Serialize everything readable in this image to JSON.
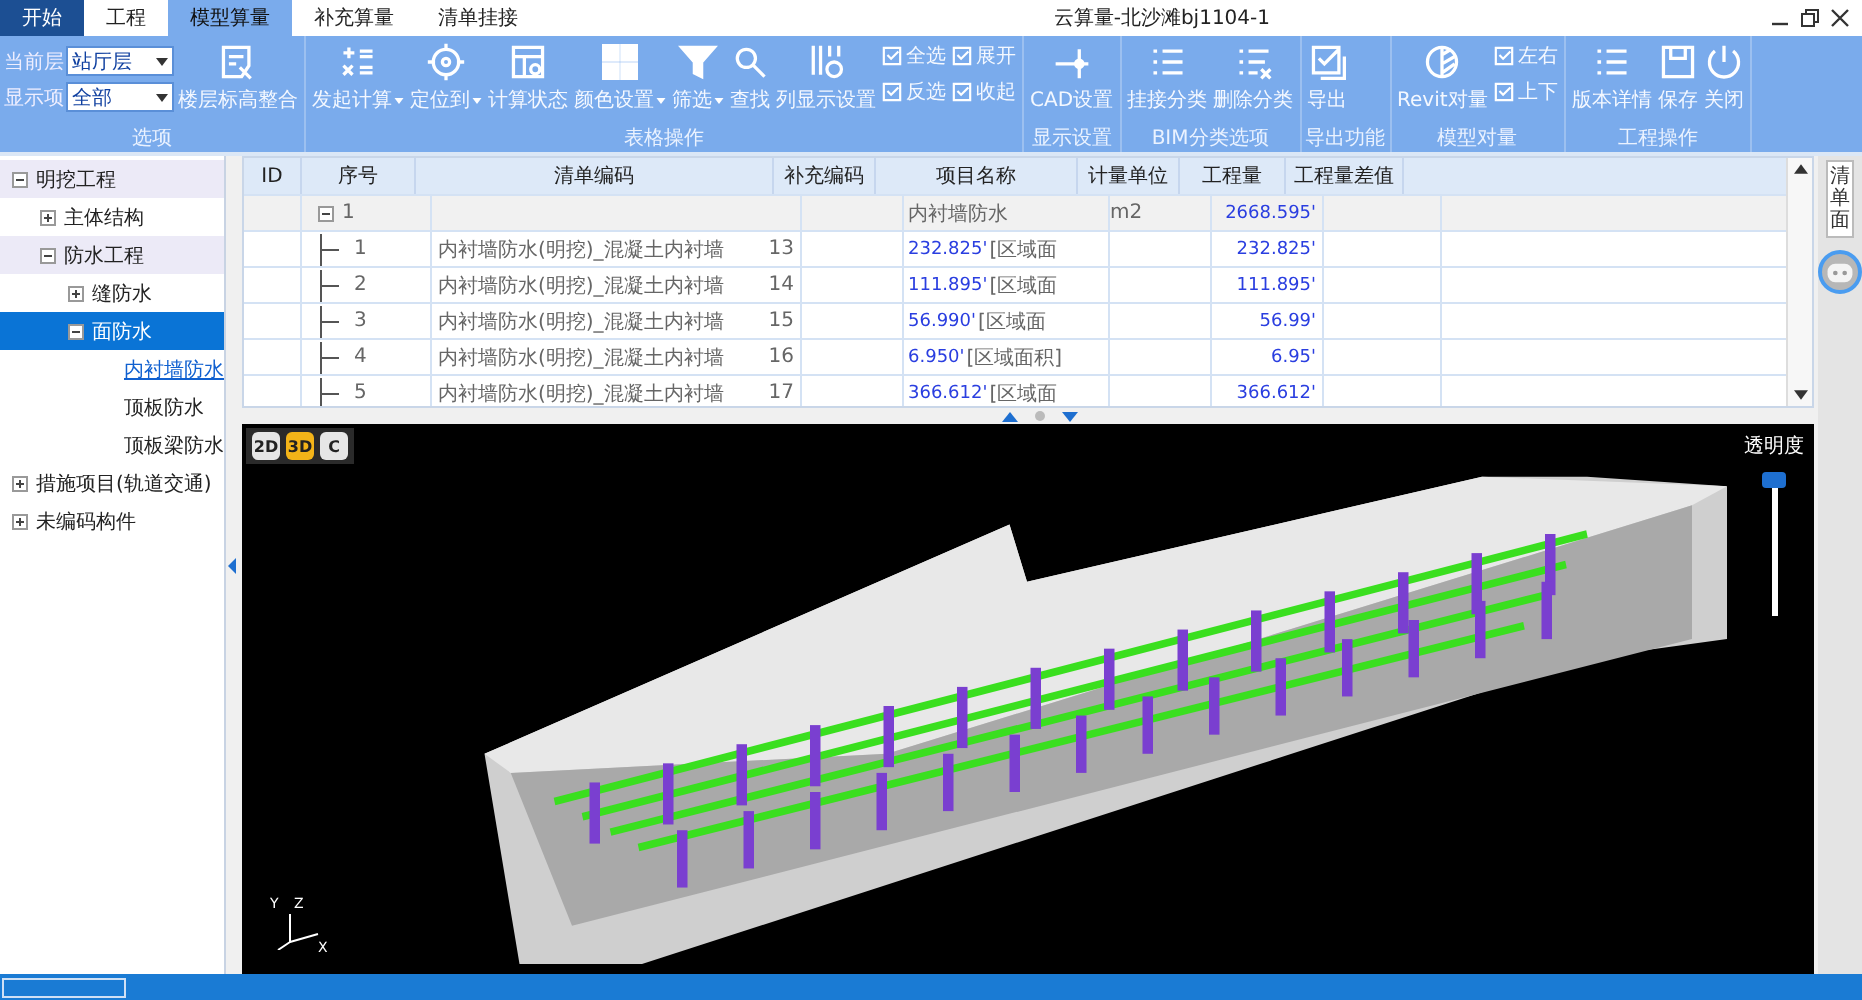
{
  "window": {
    "title": "云算量-北沙滩bj1104-1"
  },
  "tabs": [
    {
      "label": "开始",
      "kind": "start",
      "selected": false
    },
    {
      "label": "工程",
      "kind": "tab",
      "selected": false
    },
    {
      "label": "模型算量",
      "kind": "tab",
      "selected": true
    },
    {
      "label": "补充算量",
      "kind": "tab",
      "selected": false
    },
    {
      "label": "清单挂接",
      "kind": "tab",
      "selected": false
    }
  ],
  "ribbon": {
    "groups": [
      {
        "caption": "选项",
        "items": [
          {
            "kind": "selects",
            "fields": [
              {
                "label": "当前层",
                "value": "站厅层"
              },
              {
                "label": "显示项",
                "value": "全部"
              }
            ]
          },
          {
            "kind": "big",
            "label": "楼层标高整合"
          }
        ]
      },
      {
        "caption": "表格操作",
        "items": [
          {
            "kind": "big",
            "label": "发起计算",
            "dropdown": true
          },
          {
            "kind": "big",
            "label": "定位到",
            "dropdown": true
          },
          {
            "kind": "big",
            "label": "计算状态"
          },
          {
            "kind": "big",
            "label": "颜色设置",
            "dropdown": true
          },
          {
            "kind": "big",
            "label": "筛选",
            "dropdown": true
          },
          {
            "kind": "big",
            "label": "查找"
          },
          {
            "kind": "big",
            "label": "列显示设置"
          },
          {
            "kind": "pair",
            "entries": [
              "全选",
              "反选"
            ]
          },
          {
            "kind": "pair",
            "entries": [
              "展开",
              "收起"
            ]
          }
        ]
      },
      {
        "caption": "显示设置",
        "items": [
          {
            "kind": "big",
            "label": "CAD设置"
          }
        ]
      },
      {
        "caption": "BIM分类选项",
        "items": [
          {
            "kind": "big",
            "label": "挂接分类"
          },
          {
            "kind": "big",
            "label": "删除分类"
          }
        ]
      },
      {
        "caption": "导出功能",
        "items": [
          {
            "kind": "big",
            "label": "导出"
          }
        ]
      },
      {
        "caption": "模型对量",
        "items": [
          {
            "kind": "big",
            "label": "Revit对量"
          },
          {
            "kind": "pair",
            "entries": [
              "左右",
              "上下"
            ]
          }
        ]
      },
      {
        "caption": "工程操作",
        "items": [
          {
            "kind": "big",
            "label": "版本详情"
          },
          {
            "kind": "big",
            "label": "保存"
          },
          {
            "kind": "big",
            "label": "关闭"
          }
        ]
      }
    ]
  },
  "sidebar": {
    "tree": [
      {
        "label": "明挖工程",
        "expanded": true,
        "selected": false,
        "children": [
          {
            "label": "主体结构",
            "expanded": false,
            "selected": false
          },
          {
            "label": "防水工程",
            "expanded": true,
            "selected": false,
            "children": [
              {
                "label": "缝防水",
                "expanded": false,
                "selected": false
              },
              {
                "label": "面防水",
                "expanded": true,
                "selected": true,
                "children": [
                  {
                    "label": "内衬墙防水",
                    "active": true
                  },
                  {
                    "label": "顶板防水",
                    "active": false
                  },
                  {
                    "label": "顶板梁防水",
                    "active": false
                  }
                ]
              }
            ]
          }
        ]
      },
      {
        "label": "措施项目(轨道交通)",
        "expanded": false,
        "selected": false
      },
      {
        "label": "未编码构件",
        "expanded": false,
        "selected": false
      }
    ]
  },
  "table": {
    "columns": [
      "ID",
      "序号",
      "清单编码",
      "补充编码",
      "项目名称",
      "计量单位",
      "工程量",
      "工程量差值"
    ],
    "rows": [
      {
        "kind": "group",
        "index": "1",
        "name_text": "内衬墙防水",
        "unit": "m2",
        "quantity": "2668.595'"
      },
      {
        "kind": "item",
        "index": "1",
        "code_name": "内衬墙防水(明挖)_混凝土内衬墙",
        "code_num": "13",
        "name_value": "232.825'",
        "name_text": "[区域面",
        "quantity": "232.825'"
      },
      {
        "kind": "item",
        "index": "2",
        "code_name": "内衬墙防水(明挖)_混凝土内衬墙",
        "code_num": "14",
        "name_value": "111.895'",
        "name_text": "[区域面",
        "quantity": "111.895'"
      },
      {
        "kind": "item",
        "index": "3",
        "code_name": "内衬墙防水(明挖)_混凝土内衬墙",
        "code_num": "15",
        "name_value": "56.990'",
        "name_text": "[区域面",
        "quantity": "56.99'"
      },
      {
        "kind": "item",
        "index": "4",
        "code_name": "内衬墙防水(明挖)_混凝土内衬墙",
        "code_num": "16",
        "name_value": "6.950'",
        "name_text": "[区域面积]",
        "quantity": "6.95'"
      },
      {
        "kind": "item",
        "index": "5",
        "code_name": "内衬墙防水(明挖)_混凝土内衬墙",
        "code_num": "17",
        "name_value": "366.612'",
        "name_text": "[区域面",
        "quantity": "366.612'"
      }
    ]
  },
  "viewer": {
    "view_modes": [
      {
        "label": "2D",
        "selected": false
      },
      {
        "label": "3D",
        "selected": true
      },
      {
        "label": "C",
        "selected": false
      }
    ],
    "axes": {
      "x": "X",
      "y": "Y",
      "z": "Z"
    },
    "transparency": {
      "label": "透明度",
      "level": 1
    }
  },
  "side_panel": {
    "label": "清单面"
  }
}
